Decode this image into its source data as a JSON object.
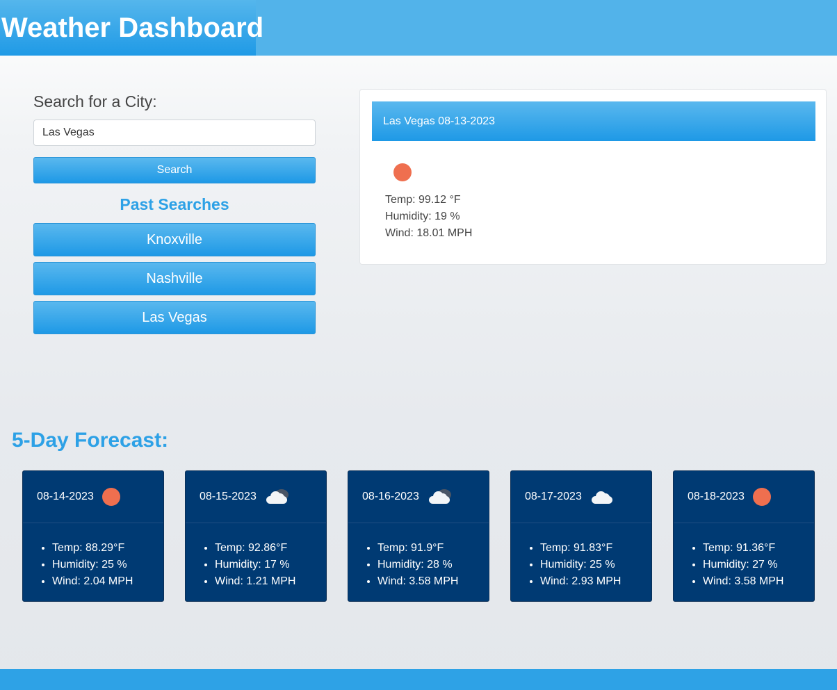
{
  "header": {
    "title": "Weather Dashboard"
  },
  "search": {
    "label": "Search for a City:",
    "value": "Las Vegas",
    "button_label": "Search"
  },
  "past_searches": {
    "title": "Past Searches",
    "items": [
      "Knoxville",
      "Nashville",
      "Las Vegas"
    ]
  },
  "current": {
    "header": "Las Vegas 08-13-2023",
    "icon": "sun-icon",
    "temp": "Temp: 99.12 °F",
    "humidity": "Humidity: 19 %",
    "wind": "Wind: 18.01 MPH"
  },
  "forecast": {
    "title": "5-Day Forecast:",
    "days": [
      {
        "date": "08-14-2023",
        "icon": "sun-icon",
        "temp": "Temp: 88.29°F",
        "humidity": "Humidity: 25 %",
        "wind": "Wind: 2.04 MPH"
      },
      {
        "date": "08-15-2023",
        "icon": "broken-clouds-icon",
        "temp": "Temp: 92.86°F",
        "humidity": "Humidity: 17 %",
        "wind": "Wind: 1.21 MPH"
      },
      {
        "date": "08-16-2023",
        "icon": "broken-clouds-icon",
        "temp": "Temp: 91.9°F",
        "humidity": "Humidity: 28 %",
        "wind": "Wind: 3.58 MPH"
      },
      {
        "date": "08-17-2023",
        "icon": "cloud-icon",
        "temp": "Temp: 91.83°F",
        "humidity": "Humidity: 25 %",
        "wind": "Wind: 2.93 MPH"
      },
      {
        "date": "08-18-2023",
        "icon": "sun-icon",
        "temp": "Temp: 91.36°F",
        "humidity": "Humidity: 27 %",
        "wind": "Wind: 3.58 MPH"
      }
    ]
  },
  "colors": {
    "accent": "#2da1e6",
    "card_bg": "#003a73",
    "sun": "#ef6f4f"
  }
}
